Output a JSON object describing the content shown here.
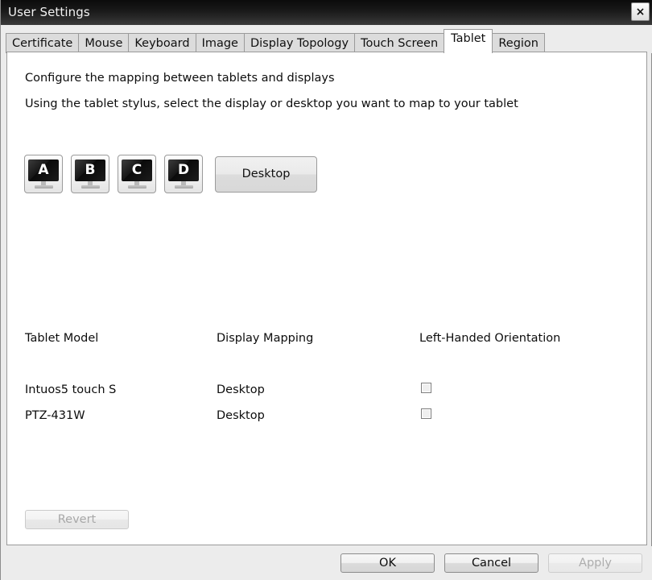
{
  "window": {
    "title": "User Settings",
    "close_label": "×"
  },
  "tabs": [
    {
      "label": "Certificate",
      "active": false
    },
    {
      "label": "Mouse",
      "active": false
    },
    {
      "label": "Keyboard",
      "active": false
    },
    {
      "label": "Image",
      "active": false
    },
    {
      "label": "Display Topology",
      "active": false
    },
    {
      "label": "Touch Screen",
      "active": false
    },
    {
      "label": "Tablet",
      "active": true
    },
    {
      "label": "Region",
      "active": false
    }
  ],
  "content": {
    "description_line1": "Configure the mapping between tablets and displays",
    "description_line2": "Using the tablet stylus, select the display or desktop you want to map to your tablet",
    "display_targets": [
      {
        "letter": "A",
        "name": "display-a"
      },
      {
        "letter": "B",
        "name": "display-b"
      },
      {
        "letter": "C",
        "name": "display-c"
      },
      {
        "letter": "D",
        "name": "display-d"
      }
    ],
    "desktop_button_label": "Desktop",
    "table": {
      "headers": [
        "Tablet Model",
        "Display Mapping",
        "Left-Handed Orientation"
      ],
      "rows": [
        {
          "model": "Intuos5 touch S",
          "mapping": "Desktop",
          "left_handed": false
        },
        {
          "model": "PTZ-431W",
          "mapping": "Desktop",
          "left_handed": false
        }
      ]
    },
    "revert_label": "Revert"
  },
  "footer": {
    "ok_label": "OK",
    "cancel_label": "Cancel",
    "apply_label": "Apply"
  },
  "colors": {
    "titlebar_dark": "#0b0b0b",
    "window_bg": "#ececec",
    "panel_bg": "#ffffff",
    "border": "#9a9a9a",
    "text": "#0d0d0d",
    "disabled_text": "#a8a8a8"
  }
}
